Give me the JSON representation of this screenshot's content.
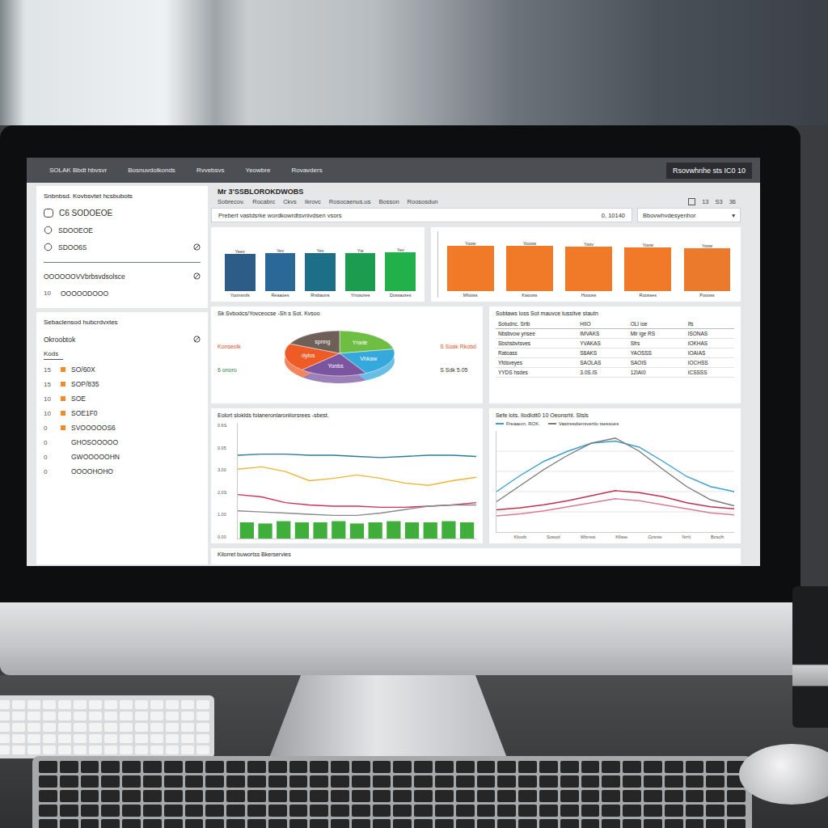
{
  "nav": {
    "items": [
      "SOLAK Bbdt hbvsvr",
      "Bosnuvdolkonds",
      "Rvvebsvs",
      "Yeowbre",
      "Rovavders"
    ],
    "badge": "Rsovwhnhe sts IC0 10"
  },
  "sidebar": {
    "top_card": {
      "title": "Snbnbsd. Kovbsvtet hcsbubots",
      "rows": [
        {
          "label": "C6 SODOEOE",
          "kind": "logo"
        },
        {
          "label": "SDOOEOE",
          "kind": "icon"
        },
        {
          "label": "SDOO6S",
          "kind": "icon-trail"
        }
      ],
      "sub_rows": [
        {
          "count": "",
          "label": "OOOOOOVVbrbsvdsolsce",
          "kind": "trail"
        },
        {
          "count": "10",
          "label": "OOOOODOOO",
          "kind": "count"
        }
      ]
    },
    "list_card": {
      "title": "Sebaclensod hubcrdvxtes",
      "select": "Okroobtok",
      "tab": "Kods",
      "items": [
        {
          "count": "15",
          "label": "SO/60X",
          "marked": true
        },
        {
          "count": "15",
          "label": "SOP/835",
          "marked": true
        },
        {
          "count": "10",
          "label": "SOE",
          "marked": true
        },
        {
          "count": "10",
          "label": "SOE1F0",
          "marked": true
        },
        {
          "count": "0",
          "label": "SVOOOOOS6",
          "marked": true
        },
        {
          "count": "0",
          "label": "GHOSOOOOO",
          "marked": false
        },
        {
          "count": "0",
          "label": "GWOOOOOHN",
          "marked": false
        },
        {
          "count": "0",
          "label": "OOOOHOHO",
          "marked": false
        }
      ]
    }
  },
  "header": {
    "title": "Mr 3'SSBLOROKDWOBS",
    "subtitle": [
      "Sobrecov.",
      "Rocabrc",
      "Ckvs",
      "Ikrovc",
      "Rosocaenus.us",
      "Bosson",
      "Roososdun"
    ],
    "meta": [
      "13",
      "S3",
      "36"
    ],
    "search": {
      "value": "Prebert vastdsrke wordkowrdtsvnivdsen vsors",
      "count": "0, 10140"
    },
    "dropdown": {
      "value": "Bbovwhvdesyenhor",
      "arrow": "▾"
    }
  },
  "bar_chart_1": {
    "bars": [
      {
        "top": "Yeev",
        "bottom": "Yoonsrols",
        "value": 70,
        "color": "#2d5d86"
      },
      {
        "top": "Yev",
        "bottom": "Reaaoes",
        "value": 71,
        "color": "#2a6897"
      },
      {
        "top": "Yev",
        "bottom": "Rrsbaons",
        "value": 72,
        "color": "#1c6f86"
      },
      {
        "top": "Yw",
        "bottom": "Yrrosores",
        "value": 72,
        "color": "#1c9c4e"
      },
      {
        "top": "Yev",
        "bottom": "Dossaores",
        "value": 73,
        "color": "#22b04a"
      }
    ]
  },
  "bar_chart_2": {
    "bars": [
      {
        "top": "Yoow",
        "bottom": "Mfooss",
        "value": 86,
        "color": "#f07a28"
      },
      {
        "top": "Yooow",
        "bottom": "Kwooss",
        "value": 85,
        "color": "#f07a28"
      },
      {
        "top": "Yoov",
        "bottom": "Hoooss",
        "value": 84,
        "color": "#f07a28"
      },
      {
        "top": "Yoow",
        "bottom": "Roosses",
        "value": 83,
        "color": "#f07a28"
      },
      {
        "top": "Yoow",
        "bottom": "Poooss",
        "value": 81,
        "color": "#ec7a2c"
      }
    ]
  },
  "pie_chart": {
    "title": "Sk Svbodcs/Yovceocse -Sh s Sot. Kvsoo",
    "left_top": "Konseolk",
    "left": "6 onoro",
    "right_top": "S Soak Rkobd",
    "right": "S Sdk 5.05",
    "slices": [
      {
        "label": "Yrade",
        "value": 22,
        "color": "#6fbe44"
      },
      {
        "label": "Vhkaw",
        "value": 20,
        "color": "#35a8dc"
      },
      {
        "label": "Yonbs",
        "value": 20,
        "color": "#7b55a0"
      },
      {
        "label": "dylos",
        "value": 20,
        "color": "#ef5b25"
      },
      {
        "label": "spnng",
        "value": 18,
        "color": "#6e5f58"
      }
    ]
  },
  "table": {
    "title": "Sobtaws loss Sot mauvce tussitve stautn",
    "columns": [
      "Sotudnc. Srtb",
      "HIIO",
      "OLI ioe",
      "Ifs"
    ],
    "rows": [
      [
        "Nbsbvow ynsee",
        "IMVAKS",
        "Mlr ige RS",
        "ISONAS"
      ],
      [
        "Sbshsbvtsves",
        "YVAKAS",
        "Sfrs",
        "IOKHAS"
      ],
      [
        "Ratoass",
        "S8AKS",
        "YAOSSS",
        "IOAIAS"
      ],
      [
        "Yfdsveyes",
        "SAOLAS",
        "SAOIS",
        "IOCHSS"
      ],
      [
        "YYDS hsdes",
        "3.0S.IS",
        "12IAI0",
        "ICSSSS"
      ]
    ]
  },
  "line_chart_1": {
    "title": "Eolort sloklds folaneronlaronliorsrees -sbest.",
    "ticks": [
      "0.6S",
      "0.05",
      "3.00",
      "2.0S",
      "1.00",
      "0.00"
    ],
    "series": [
      {
        "values": [
          72,
          73,
          73,
          72,
          72,
          71,
          70,
          71,
          72,
          72,
          71
        ],
        "color": "#2a7a96"
      },
      {
        "values": [
          60,
          62,
          58,
          50,
          52,
          55,
          52,
          48,
          46,
          50,
          53
        ],
        "color": "#f0b432"
      },
      {
        "values": [
          38,
          36,
          31,
          29,
          28,
          28,
          27,
          27,
          28,
          29,
          31
        ],
        "color": "#d0325a"
      },
      {
        "values": [
          24,
          23,
          22,
          21,
          20,
          20,
          22,
          25,
          28,
          29,
          29
        ],
        "color": "#8a8a8a"
      }
    ],
    "bars": {
      "values": [
        14,
        13,
        15,
        14,
        14,
        15,
        13,
        14,
        15,
        14,
        14,
        15,
        14
      ],
      "color": "#3fae3a"
    }
  },
  "line_chart_2": {
    "title": "Sefe lots. Ilodlott0 10 Oeonsrhl. Stsls",
    "legend": [
      "Freaaom. ROK.",
      "Vastresdiensvertlo tsessoes"
    ],
    "ticks": [
      "Kfooib",
      "Sosool",
      "Wbnsst",
      "Kflsse",
      "Cosnte",
      "Nrrlt",
      "Bosclh"
    ],
    "series": [
      {
        "values": [
          40,
          56,
          70,
          80,
          88,
          90,
          84,
          70,
          55,
          45,
          40
        ],
        "color": "#3a9fd0"
      },
      {
        "values": [
          30,
          46,
          62,
          76,
          88,
          93,
          80,
          62,
          45,
          32,
          26
        ],
        "color": "#7a7a7a"
      },
      {
        "values": [
          22,
          24,
          27,
          31,
          36,
          41,
          39,
          35,
          29,
          25,
          23
        ],
        "color": "#c0304e"
      },
      {
        "values": [
          16,
          18,
          21,
          25,
          29,
          33,
          31,
          27,
          23,
          19,
          17
        ],
        "color": "#d77a95"
      }
    ]
  },
  "footer": "Kilorret buwortss Bkerservies"
}
